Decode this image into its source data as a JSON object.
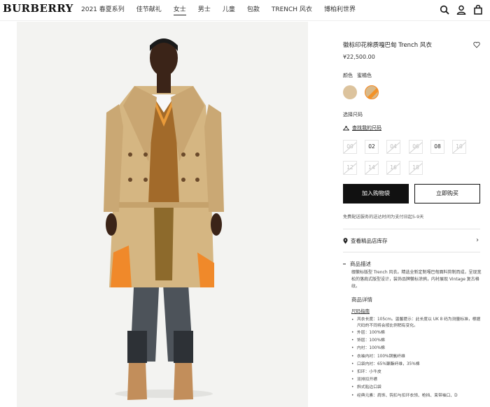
{
  "header": {
    "logo": "BURBERRY",
    "nav": [
      "2021 春夏系列",
      "佳节献礼",
      "女士",
      "男士",
      "儿童",
      "包款",
      "TRENCH 风衣",
      "博柏利世界"
    ],
    "active_nav_index": 2,
    "icons": [
      "search-icon",
      "account-icon",
      "bag-icon"
    ]
  },
  "product": {
    "title": "徽标印花棉质嘎巴甸 Trench 风衣",
    "price": "¥22,500.00",
    "color_label": "颜色",
    "color_value": "蜜橘色",
    "size_label": "选择尺码",
    "size_guide": "查找我的尺码",
    "sizes": [
      {
        "label": "00",
        "available": false
      },
      {
        "label": "02",
        "available": true
      },
      {
        "label": "04",
        "available": false
      },
      {
        "label": "06",
        "available": false
      },
      {
        "label": "08",
        "available": true
      },
      {
        "label": "10",
        "available": false
      },
      {
        "label": "12",
        "available": false
      },
      {
        "label": "14",
        "available": false
      },
      {
        "label": "16",
        "available": false
      },
      {
        "label": "18",
        "available": false
      }
    ],
    "add_to_bag": "加入购物袋",
    "buy_now": "立即购买",
    "shipping_note": "免费配送服务的送达时间为支付日起5-9天",
    "store_stock": "查看精品店库存",
    "description_title": "商品描述",
    "description": "缀徽标版型 Trench 风衣。精选全新定制嘎巴甸面料剪制而成，呈现宽松的落肩式版型设计，装饰品牌徽标涂鸦，内衬展现 Vintage 复古格纹。",
    "details_title": "商品详情",
    "size_chart_link": "尺码指南",
    "details": [
      "风衣长度：105cm。温馨提示：此长度以 UK 8 码为测量标准，根据尺码的不同将会按比例稍有变化。",
      "外层：100%棉",
      "饰层：100%棉",
      "内衬：100%棉",
      "衣袖内衬：100%铜氨纤维",
      "口袋内衬：65%聚酯纤维，35%棉",
      "扣环：小牛皮",
      "双排扣开襟",
      "斜式贴边口袋",
      "经典元素：肩饰、钩扣与扣环衣领、枪挡、束带袖口、D"
    ]
  },
  "colors": {
    "swatch_honey": "#dcc39d",
    "swatch_orange": "#f39227",
    "primary_button": "#111111"
  }
}
